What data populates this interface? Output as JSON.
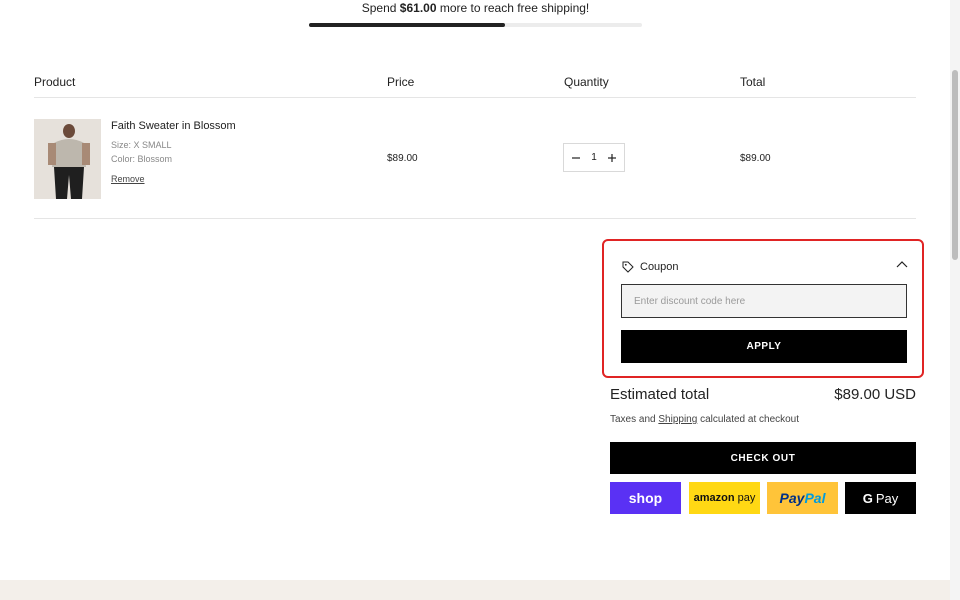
{
  "shipping": {
    "prefix": "Spend ",
    "amount": "$61.00",
    "suffix": " more to reach free shipping!",
    "progress_percent": 59
  },
  "table": {
    "headers": [
      "Product",
      "Price",
      "Quantity",
      "Total"
    ]
  },
  "cart_item": {
    "name": "Faith Sweater in Blossom",
    "size": "Size: X SMALL",
    "color": "Color: Blossom",
    "remove_label": "Remove",
    "price": "$89.00",
    "quantity": "1",
    "total": "$89.00"
  },
  "coupon": {
    "title": "Coupon",
    "placeholder": "Enter discount code here",
    "apply_label": "APPLY"
  },
  "summary": {
    "estimated_label": "Estimated total",
    "estimated_value": "$89.00 USD",
    "tax_prefix": "Taxes and ",
    "tax_link": "Shipping",
    "tax_suffix": " calculated at checkout",
    "checkout_label": "CHECK OUT"
  },
  "payments": {
    "shop": "shop",
    "amazon_word": "amazon",
    "amazon_pay": "pay",
    "paypal_1": "Pay",
    "paypal_2": "Pal",
    "gpay_g": "G",
    "gpay_pay": "Pay"
  },
  "colors": {
    "highlight": "#e02424",
    "shop_purple": "#5a31f4",
    "amazon_yellow": "#ffd814",
    "paypal_yellow": "#ffc439"
  }
}
